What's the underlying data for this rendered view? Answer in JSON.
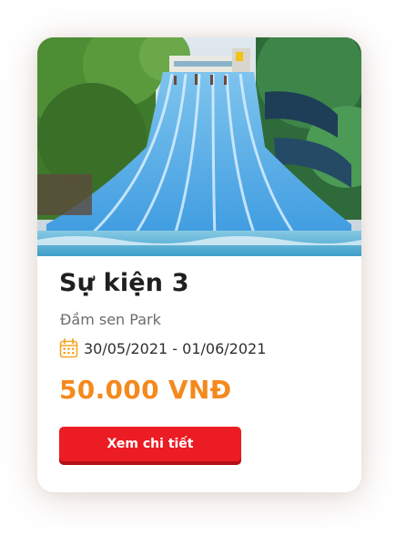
{
  "event": {
    "image_alt": "Water park slides",
    "title": "Sự kiện 3",
    "location": "Đầm sen Park",
    "date_range": "30/05/2021 - 01/06/2021",
    "price": "50.000 VNĐ",
    "cta_label": "Xem chi tiết"
  },
  "icons": {
    "date": "calendar-icon"
  },
  "colors": {
    "price": "#f5891e",
    "button": "#ec1c24",
    "calendar_icon": "#f5a623"
  }
}
